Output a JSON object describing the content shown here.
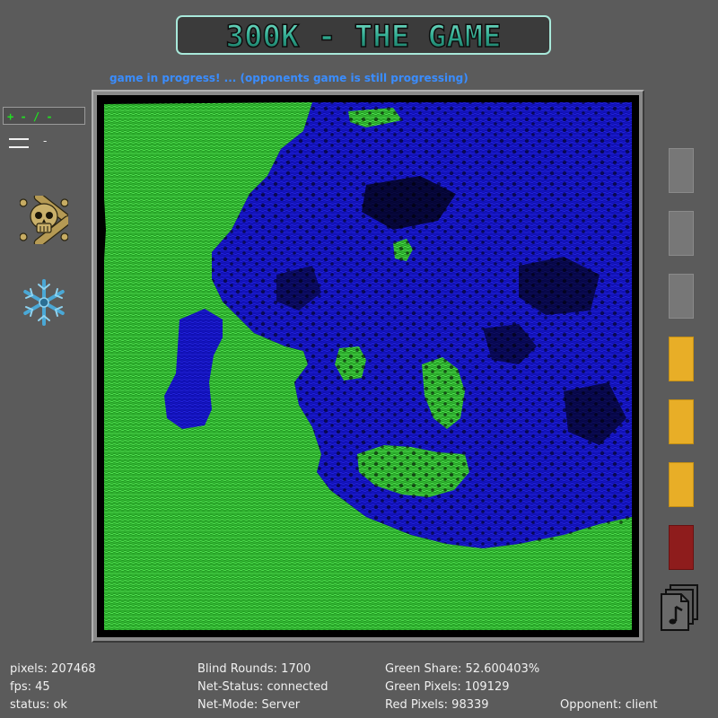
{
  "title": {
    "text": "300K - THE GAME"
  },
  "status_message": "game in progress! ... (opponents game is still progressing)",
  "score_box": "+ - / -",
  "menu_label": "-",
  "side_icons": {
    "skull": "skull-crossbones-icon",
    "snowflake": "snowflake-icon",
    "music": "music-files-icon"
  },
  "colors": {
    "background": "#5b5b5b",
    "green_player": "#2fc42f",
    "blue_player": "#1313c8",
    "board_bg": "#000000",
    "status_text": "#3a8dff",
    "slot_grey": "#777777",
    "slot_yellow": "#e8ae27",
    "slot_red": "#8e1c1c"
  },
  "slots": [
    "grey",
    "grey",
    "grey",
    "yellow",
    "yellow",
    "yellow",
    "red"
  ],
  "stats": {
    "pixels": "pixels: 207468",
    "fps": "fps: 45",
    "status": "status: ok",
    "blind_rounds": "Blind Rounds: 1700",
    "net_status": "Net-Status: connected",
    "net_mode": "Net-Mode: Server",
    "green_share": "Green Share: 52.600403%",
    "green_pixels": "Green Pixels: 109129",
    "red_pixels": "Red Pixels: 98339",
    "opponent": "Opponent: client"
  }
}
